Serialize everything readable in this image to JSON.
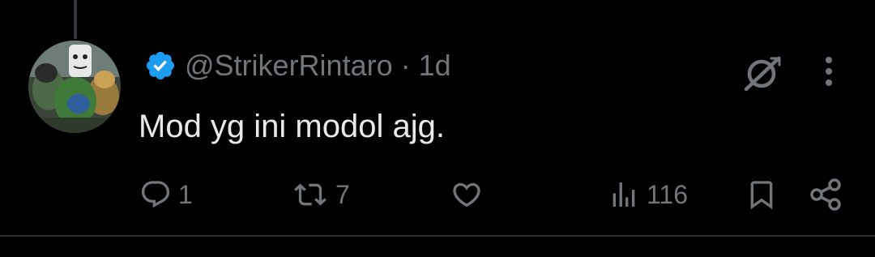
{
  "post": {
    "handle": "@StrikerRintaro",
    "separator": "·",
    "timestamp": "1d",
    "text": "Mod yg ini modol ajg."
  },
  "actions": {
    "reply_count": "1",
    "retweet_count": "7",
    "like_count": "",
    "views_count": "116"
  },
  "icons": {
    "verified": "verified-badge-icon",
    "grok": "grok-icon",
    "more": "more-icon",
    "reply": "reply-icon",
    "retweet": "retweet-icon",
    "like": "like-icon",
    "views": "views-icon",
    "bookmark": "bookmark-icon",
    "share": "share-icon"
  },
  "colors": {
    "background": "#000000",
    "text": "#e7e9ea",
    "muted": "#71767b",
    "verified_blue": "#1d9bf0",
    "divider": "#2f3336"
  }
}
